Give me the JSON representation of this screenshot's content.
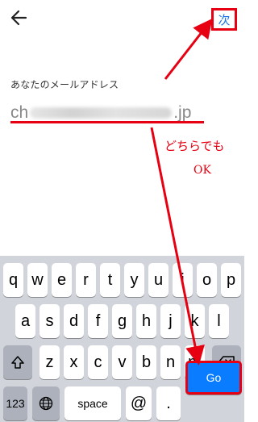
{
  "header": {
    "next_label": "次"
  },
  "form": {
    "label": "あなたのメールアドレス",
    "email_prefix": "ch",
    "email_suffix": ".jp"
  },
  "annotation": {
    "line1": "どちらでも",
    "line2": "OK"
  },
  "keyboard": {
    "row1": [
      "q",
      "w",
      "e",
      "r",
      "t",
      "y",
      "u",
      "i",
      "o",
      "p"
    ],
    "row2": [
      "a",
      "s",
      "d",
      "f",
      "g",
      "h",
      "j",
      "k",
      "l"
    ],
    "row3": [
      "z",
      "x",
      "c",
      "v",
      "b",
      "n",
      "m"
    ],
    "numbers_label": "123",
    "space_label": "space",
    "at_label": "@",
    "dot_label": ".",
    "go_label": "Go"
  },
  "colors": {
    "annotation": "#e60012",
    "link": "#1a73e8",
    "go_key": "#0a7cff"
  }
}
